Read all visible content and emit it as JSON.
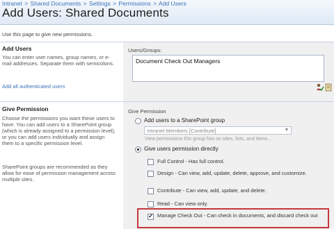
{
  "header": {
    "breadcrumb": [
      "Intranet",
      "Shared Documents",
      "Settings",
      "Permissions",
      "Add Users"
    ],
    "breadcrumb_separator": ">",
    "title": "Add Users: Shared Documents"
  },
  "description": "Use this page to give new permissions.",
  "add_users": {
    "title": "Add Users",
    "text": "You can enter user names, group names, or e-mail addresses. Separate them with semicolons.",
    "link": "Add all authenticated users",
    "field_label": "Users/Groups:",
    "value": "Document Check Out Managers"
  },
  "give_permission": {
    "title": "Give Permission",
    "text1": "Choose the permissions you want these users to have. You can add users to a SharePoint group (which is already assigned to a permission level), or you can add users individually and assign them to a specific permission level.",
    "text2": "SharePoint groups are recommended as they allow for ease of permission management across multiple sites.",
    "field_label": "Give Permission",
    "option_group": "Add users to a SharePoint group",
    "group_select": "Intranet Members [Contribute]",
    "group_hint": "View permissions this group has on sites, lists, and items...",
    "option_direct": "Give users permission directly",
    "levels": [
      {
        "label": "Full Control - Has full control.",
        "checked": false
      },
      {
        "label": "Design - Can view, add, update, delete, approve, and customize.",
        "checked": false
      },
      {
        "label": "Contribute - Can view, add, update, and delete.",
        "checked": false
      },
      {
        "label": "Read - Can view only.",
        "checked": false
      },
      {
        "label": "Manage Check Out - Can check in documents, and discard check out",
        "checked": true
      }
    ]
  },
  "colors": {
    "link": "#3b73b9",
    "highlight": "#c4373b",
    "panel": "#f0f0f0"
  }
}
